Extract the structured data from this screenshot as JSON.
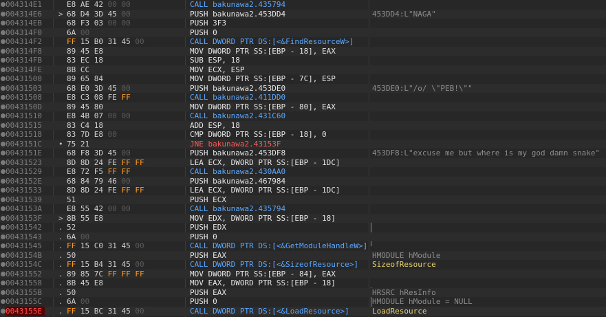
{
  "rows": [
    {
      "addr": "004314E1",
      "arrow": "",
      "b": [
        [
          "E8",
          ""
        ],
        [
          "AE",
          ""
        ],
        [
          "42",
          ""
        ],
        [
          "00",
          "d"
        ],
        [
          "00",
          "d"
        ]
      ],
      "asm": "CALL bakunawa2.435794",
      "type": "call",
      "cmt": ""
    },
    {
      "addr": "004314E6",
      "arrow": ">",
      "b": [
        [
          "68",
          ""
        ],
        [
          "D4",
          ""
        ],
        [
          "3D",
          ""
        ],
        [
          "45",
          ""
        ],
        [
          "00",
          "d"
        ]
      ],
      "asm": "PUSH bakunawa2.453DD4",
      "type": "",
      "cmt": "453DD4:L\"NAGA\""
    },
    {
      "addr": "004314EB",
      "arrow": "",
      "b": [
        [
          "68",
          ""
        ],
        [
          "F3",
          ""
        ],
        [
          "03",
          ""
        ],
        [
          "00",
          "d"
        ],
        [
          "00",
          "d"
        ]
      ],
      "asm": "PUSH 3F3",
      "type": "",
      "cmt": ""
    },
    {
      "addr": "004314F0",
      "arrow": "",
      "b": [
        [
          "6A",
          ""
        ],
        [
          "00",
          "d"
        ]
      ],
      "asm": "PUSH 0",
      "type": "",
      "cmt": ""
    },
    {
      "addr": "004314F2",
      "arrow": "",
      "b": [
        [
          "FF",
          "o"
        ],
        [
          "15",
          ""
        ],
        [
          "B0",
          ""
        ],
        [
          "31",
          ""
        ],
        [
          "45",
          ""
        ],
        [
          "00",
          "d"
        ]
      ],
      "asm": "CALL DWORD PTR DS:[<&FindResourceW>]",
      "type": "call",
      "cmt": ""
    },
    {
      "addr": "004314F8",
      "arrow": "",
      "b": [
        [
          "89",
          ""
        ],
        [
          "45",
          ""
        ],
        [
          "E8",
          ""
        ]
      ],
      "asm": "MOV DWORD PTR SS:[EBP - 18], EAX",
      "type": "",
      "cmt": ""
    },
    {
      "addr": "004314FB",
      "arrow": "",
      "b": [
        [
          "83",
          ""
        ],
        [
          "EC",
          ""
        ],
        [
          "18",
          ""
        ]
      ],
      "asm": "SUB ESP, 18",
      "type": "",
      "cmt": ""
    },
    {
      "addr": "004314FE",
      "arrow": "",
      "b": [
        [
          "8B",
          ""
        ],
        [
          "CC",
          ""
        ]
      ],
      "asm": "MOV ECX, ESP",
      "type": "",
      "cmt": ""
    },
    {
      "addr": "00431500",
      "arrow": "",
      "b": [
        [
          "89",
          ""
        ],
        [
          "65",
          ""
        ],
        [
          "84",
          ""
        ]
      ],
      "asm": "MOV DWORD PTR SS:[EBP - 7C], ESP",
      "type": "",
      "cmt": ""
    },
    {
      "addr": "00431503",
      "arrow": "",
      "b": [
        [
          "68",
          ""
        ],
        [
          "E0",
          ""
        ],
        [
          "3D",
          ""
        ],
        [
          "45",
          ""
        ],
        [
          "00",
          "d"
        ]
      ],
      "asm": "PUSH bakunawa2.453DE0",
      "type": "",
      "cmt": "453DE0:L\"/o/ \\\"PEB!\\\"\""
    },
    {
      "addr": "00431508",
      "arrow": "",
      "b": [
        [
          "E8",
          ""
        ],
        [
          "C3",
          ""
        ],
        [
          "08",
          ""
        ],
        [
          "FE",
          ""
        ],
        [
          "FF",
          "o"
        ]
      ],
      "asm": "CALL bakunawa2.411DD0",
      "type": "call",
      "cmt": ""
    },
    {
      "addr": "0043150D",
      "arrow": "",
      "b": [
        [
          "89",
          ""
        ],
        [
          "45",
          ""
        ],
        [
          "80",
          ""
        ]
      ],
      "asm": "MOV DWORD PTR SS:[EBP - 80], EAX",
      "type": "",
      "cmt": ""
    },
    {
      "addr": "00431510",
      "arrow": "",
      "b": [
        [
          "E8",
          ""
        ],
        [
          "4B",
          ""
        ],
        [
          "07",
          ""
        ],
        [
          "00",
          "d"
        ],
        [
          "00",
          "d"
        ]
      ],
      "asm": "CALL bakunawa2.431C60",
      "type": "call",
      "cmt": ""
    },
    {
      "addr": "00431515",
      "arrow": "",
      "b": [
        [
          "83",
          ""
        ],
        [
          "C4",
          ""
        ],
        [
          "18",
          ""
        ]
      ],
      "asm": "ADD ESP, 18",
      "type": "",
      "cmt": ""
    },
    {
      "addr": "00431518",
      "arrow": "",
      "b": [
        [
          "83",
          ""
        ],
        [
          "7D",
          ""
        ],
        [
          "E8",
          ""
        ],
        [
          "00",
          "d"
        ]
      ],
      "asm": "CMP DWORD PTR SS:[EBP - 18], 0",
      "type": "",
      "cmt": ""
    },
    {
      "addr": "0043151C",
      "arrow": "•",
      "b": [
        [
          "75",
          ""
        ],
        [
          "21",
          ""
        ]
      ],
      "asm": "JNE bakunawa2.43153F",
      "type": "jmp",
      "cmt": ""
    },
    {
      "addr": "0043151E",
      "arrow": "",
      "b": [
        [
          "68",
          ""
        ],
        [
          "F8",
          ""
        ],
        [
          "3D",
          ""
        ],
        [
          "45",
          ""
        ],
        [
          "00",
          "d"
        ]
      ],
      "asm": "PUSH bakunawa2.453DF8",
      "type": "",
      "cmt": "453DF8:L\"excuse me but where is my god damn snake\""
    },
    {
      "addr": "00431523",
      "arrow": "",
      "b": [
        [
          "8D",
          ""
        ],
        [
          "8D",
          ""
        ],
        [
          "24",
          ""
        ],
        [
          "FE",
          ""
        ],
        [
          "FF",
          "o"
        ],
        [
          "FF",
          "o"
        ]
      ],
      "asm": "LEA ECX, DWORD PTR SS:[EBP - 1DC]",
      "type": "",
      "cmt": ""
    },
    {
      "addr": "00431529",
      "arrow": "",
      "b": [
        [
          "E8",
          ""
        ],
        [
          "72",
          ""
        ],
        [
          "F5",
          ""
        ],
        [
          "FF",
          "o"
        ],
        [
          "FF",
          "o"
        ]
      ],
      "asm": "CALL bakunawa2.430AA0",
      "type": "call",
      "cmt": ""
    },
    {
      "addr": "0043152E",
      "arrow": "",
      "b": [
        [
          "68",
          ""
        ],
        [
          "84",
          ""
        ],
        [
          "79",
          ""
        ],
        [
          "46",
          ""
        ],
        [
          "00",
          "d"
        ]
      ],
      "asm": "PUSH bakunawa2.467984",
      "type": "",
      "cmt": ""
    },
    {
      "addr": "00431533",
      "arrow": "",
      "b": [
        [
          "8D",
          ""
        ],
        [
          "8D",
          ""
        ],
        [
          "24",
          ""
        ],
        [
          "FE",
          ""
        ],
        [
          "FF",
          "o"
        ],
        [
          "FF",
          "o"
        ]
      ],
      "asm": "LEA ECX, DWORD PTR SS:[EBP - 1DC]",
      "type": "",
      "cmt": ""
    },
    {
      "addr": "00431539",
      "arrow": "",
      "b": [
        [
          "51",
          ""
        ]
      ],
      "asm": "PUSH ECX",
      "type": "",
      "cmt": ""
    },
    {
      "addr": "0043153A",
      "arrow": "",
      "b": [
        [
          "E8",
          ""
        ],
        [
          "55",
          ""
        ],
        [
          "42",
          ""
        ],
        [
          "00",
          "d"
        ],
        [
          "00",
          "d"
        ]
      ],
      "asm": "CALL bakunawa2.435794",
      "type": "call",
      "cmt": ""
    },
    {
      "addr": "0043153F",
      "arrow": ">",
      "b": [
        [
          "8B",
          ""
        ],
        [
          "55",
          ""
        ],
        [
          "E8",
          ""
        ]
      ],
      "asm": "MOV EDX, DWORD PTR SS:[EBP - 18]",
      "type": "",
      "cmt": ""
    },
    {
      "addr": "00431542",
      "arrow": ".",
      "b": [
        [
          "52",
          ""
        ]
      ],
      "asm": "PUSH EDX",
      "type": "",
      "cmt": ""
    },
    {
      "addr": "00431543",
      "arrow": ".",
      "b": [
        [
          "6A",
          ""
        ],
        [
          "00",
          "d"
        ]
      ],
      "asm": "PUSH 0",
      "type": "",
      "cmt": ""
    },
    {
      "addr": "00431545",
      "arrow": ".",
      "b": [
        [
          "FF",
          "o"
        ],
        [
          "15",
          ""
        ],
        [
          "C0",
          ""
        ],
        [
          "31",
          ""
        ],
        [
          "45",
          ""
        ],
        [
          "00",
          "d"
        ]
      ],
      "asm": "CALL DWORD PTR DS:[<&GetModuleHandleW>]",
      "type": "call",
      "cmt": ""
    },
    {
      "addr": "0043154B",
      "arrow": ".",
      "b": [
        [
          "50",
          ""
        ]
      ],
      "asm": "PUSH EAX",
      "type": "",
      "cmt": "HMODULE hModule"
    },
    {
      "addr": "0043154C",
      "arrow": ".",
      "b": [
        [
          "FF",
          "o"
        ],
        [
          "15",
          ""
        ],
        [
          "B4",
          ""
        ],
        [
          "31",
          ""
        ],
        [
          "45",
          ""
        ],
        [
          "00",
          "d"
        ]
      ],
      "asm": "CALL DWORD PTR DS:[<&SizeofResource>]",
      "type": "call",
      "cmt": "SizeofResource",
      "cmtType": "yl"
    },
    {
      "addr": "00431552",
      "arrow": ".",
      "b": [
        [
          "89",
          ""
        ],
        [
          "85",
          ""
        ],
        [
          "7C",
          ""
        ],
        [
          "FF",
          "o"
        ],
        [
          "FF",
          "o"
        ],
        [
          "FF",
          "o"
        ]
      ],
      "asm": "MOV DWORD PTR SS:[EBP - 84], EAX",
      "type": "",
      "cmt": ""
    },
    {
      "addr": "00431558",
      "arrow": ".",
      "b": [
        [
          "8B",
          ""
        ],
        [
          "45",
          ""
        ],
        [
          "E8",
          ""
        ]
      ],
      "asm": "MOV EAX, DWORD PTR SS:[EBP - 18]",
      "type": "",
      "cmt": ""
    },
    {
      "addr": "0043155B",
      "arrow": ".",
      "b": [
        [
          "50",
          ""
        ]
      ],
      "asm": "PUSH EAX",
      "type": "",
      "cmt": "HRSRC hResInfo"
    },
    {
      "addr": "0043155C",
      "arrow": ".",
      "b": [
        [
          "6A",
          ""
        ],
        [
          "00",
          "d"
        ]
      ],
      "asm": "PUSH 0",
      "type": "",
      "cmt": "HMODULE hModule = NULL"
    },
    {
      "addr": "0043155E",
      "arrow": ".",
      "b": [
        [
          "FF",
          "o"
        ],
        [
          "15",
          ""
        ],
        [
          "BC",
          ""
        ],
        [
          "31",
          ""
        ],
        [
          "45",
          ""
        ],
        [
          "00",
          "d"
        ]
      ],
      "asm": "CALL DWORD PTR DS:[<&LoadResource>]",
      "type": "call",
      "cmt": "LoadResource",
      "cmtType": "yl",
      "current": true
    }
  ],
  "colors": {
    "background": "#272727",
    "call": "#5aa7ff",
    "jump": "#ff5a5a",
    "highlight_byte": "#ff9a20",
    "api_comment": "#e8d26a",
    "current_addr": "#ff5050"
  }
}
